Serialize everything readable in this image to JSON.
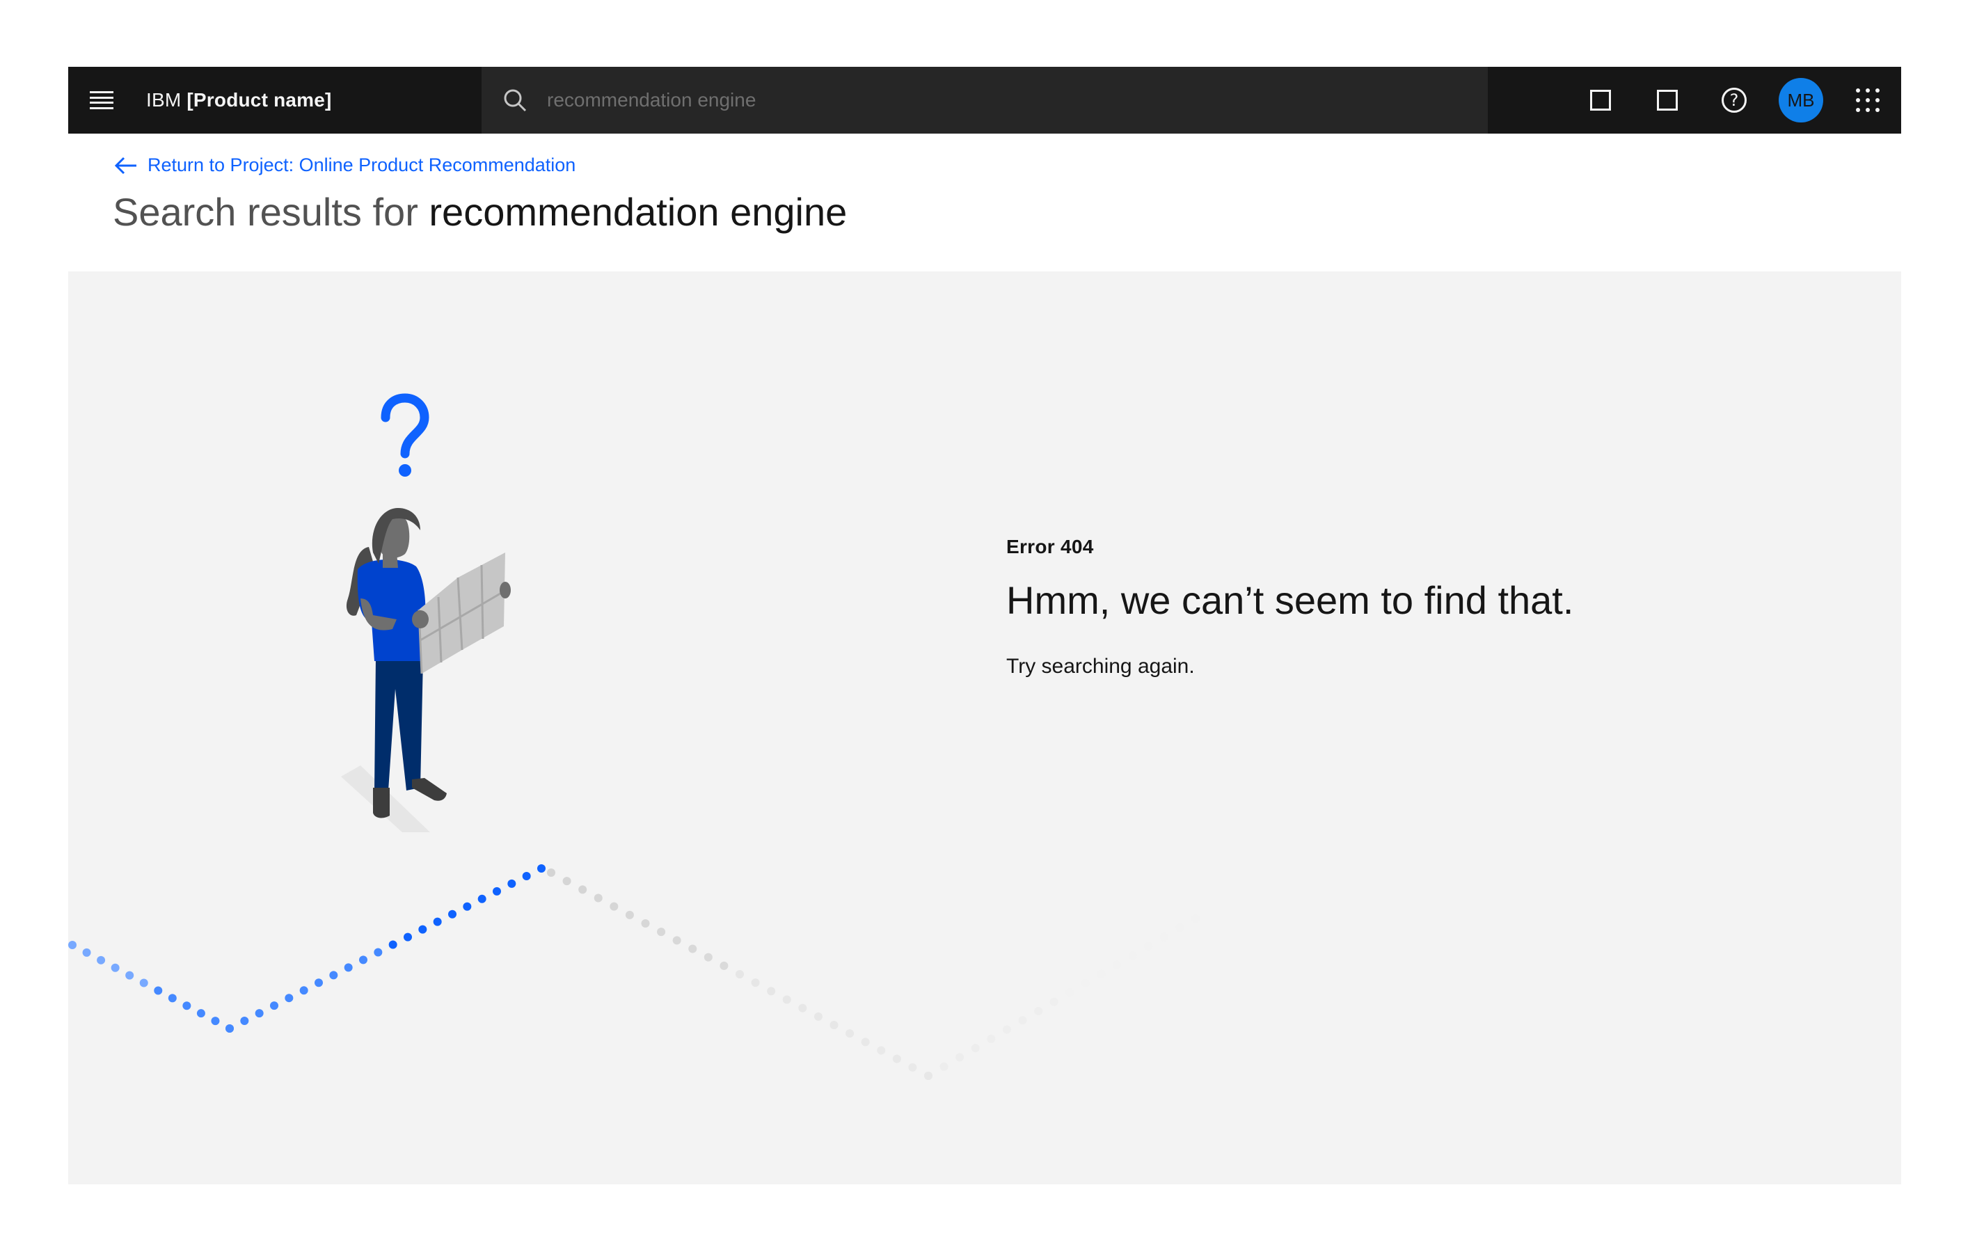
{
  "header": {
    "brand_prefix": "IBM",
    "product_name": "[Product name]",
    "search_value": "",
    "search_placeholder": "recommendation engine",
    "avatar_initials": "MB",
    "help_glyph": "?",
    "icons": [
      "menu-icon",
      "search-icon",
      "square-icon",
      "square-icon",
      "help-icon",
      "avatar",
      "app-switcher-icon"
    ]
  },
  "nav": {
    "back_link": "Return to Project: Online Product Recommendation"
  },
  "page": {
    "title_lead": "Search results for",
    "title_query": "recommendation engine"
  },
  "empty_state": {
    "code": "Error 404",
    "title": "Hmm, we can’t seem to find that.",
    "hint": "Try searching again."
  },
  "colors": {
    "header_bg": "#161616",
    "search_bg": "#262626",
    "link": "#0f62fe",
    "panel_bg": "#f3f3f3",
    "avatar_bg": "#0f7fe8",
    "figure_shirt": "#0043ce",
    "figure_pants": "#002d6b"
  }
}
